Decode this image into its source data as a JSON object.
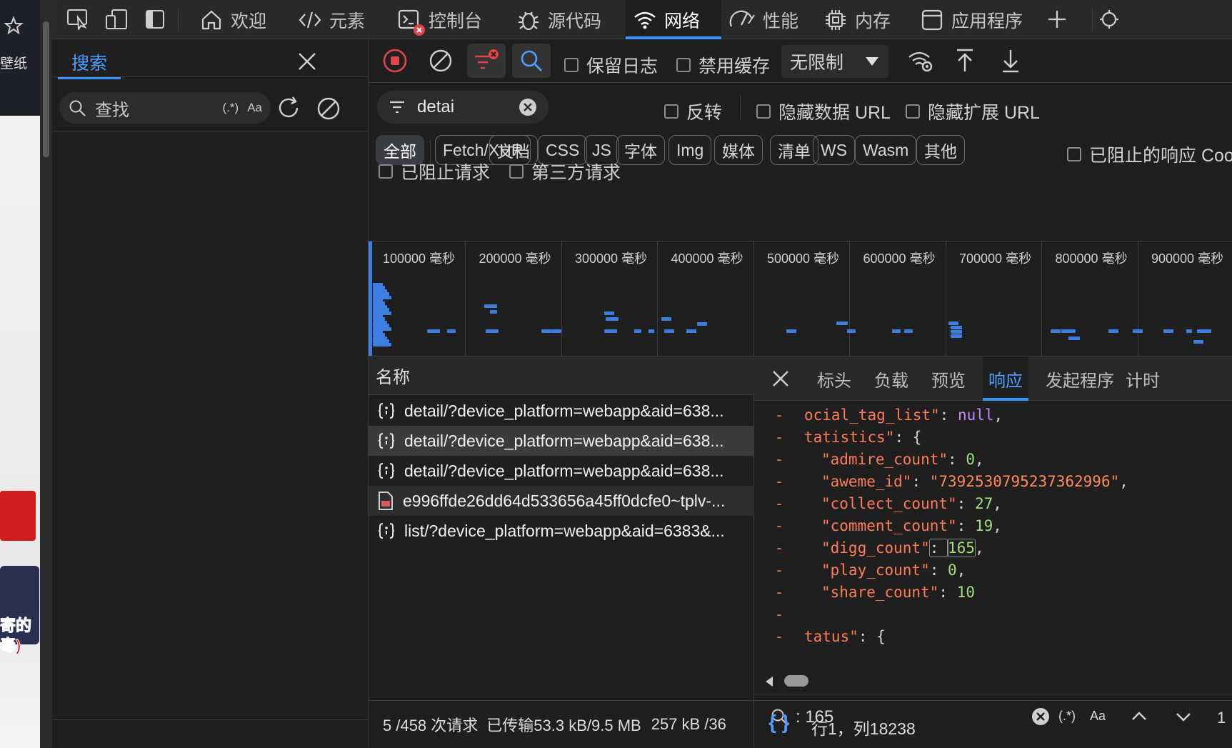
{
  "page_behind": {
    "wallpaper_label": "壁纸",
    "caption_line1": "寄的",
    "caption_line2": "毒)"
  },
  "toolbar": {
    "tabs": [
      {
        "label": "欢迎",
        "icon": "home-icon"
      },
      {
        "label": "元素",
        "icon": "code-icon"
      },
      {
        "label": "控制台",
        "icon": "console-icon"
      },
      {
        "label": "源代码",
        "icon": "bug-icon"
      },
      {
        "label": "网络",
        "icon": "wifi-icon"
      },
      {
        "label": "性能",
        "icon": "performance-icon"
      },
      {
        "label": "内存",
        "icon": "memory-chip-icon"
      },
      {
        "label": "应用程序",
        "icon": "application-icon"
      }
    ],
    "active_tab": "网络",
    "add_tab": "+"
  },
  "search_pane": {
    "tab_label": "搜索",
    "search_placeholder": "查找",
    "regex_label": "(.*)",
    "case_label": "Aa"
  },
  "network": {
    "preserve_log_label": "保留日志",
    "disable_cache_label": "禁用缓存",
    "throttling_value": "无限制",
    "filter_value": "detai",
    "invert_label": "反转",
    "hide_data_urls_label": "隐藏数据 URL",
    "hide_ext_urls_label": "隐藏扩展 URL",
    "type_filters": [
      "全部",
      "Fetch/XHR",
      "文档",
      "CSS",
      "JS",
      "字体",
      "Img",
      "媒体",
      "清单",
      "WS",
      "Wasm",
      "其他"
    ],
    "active_type_filter": "全部",
    "blocked_response_cookies_label": "已阻止的响应 Coo",
    "blocked_requests_label": "已阻止请求",
    "third_party_label": "第三方请求",
    "timeline_ticks": [
      "100000 毫秒",
      "200000 毫秒",
      "300000 毫秒",
      "400000 毫秒",
      "500000 毫秒",
      "600000 毫秒",
      "700000 毫秒",
      "800000 毫秒",
      "900000 毫秒"
    ],
    "name_column": "名称",
    "requests": [
      {
        "name": "detail/?device_platform=webapp&aid=638...",
        "icon": "fetch-icon"
      },
      {
        "name": "detail/?device_platform=webapp&aid=638...",
        "icon": "fetch-icon"
      },
      {
        "name": "detail/?device_platform=webapp&aid=638...",
        "icon": "fetch-icon"
      },
      {
        "name": "e996ffde26dd64d533656a45ff0dcfe0~tplv-...",
        "icon": "image-file-icon"
      },
      {
        "name": "list/?device_platform=webapp&aid=6383&...",
        "icon": "fetch-icon"
      }
    ],
    "status": {
      "requests": "5 /458 次请求",
      "transferred": "已传输53.3 kB/9.5 MB",
      "resources": "257 kB /36"
    }
  },
  "detail": {
    "tabs": [
      "标头",
      "负载",
      "预览",
      "响应",
      "发起程序",
      "计时"
    ],
    "active_tab": "响应",
    "code_lines": [
      {
        "gutter": "-",
        "indent": "",
        "key": "ocial_tag_list\"",
        "value": "null",
        "vtype": "nl",
        "tail": ","
      },
      {
        "gutter": "-",
        "indent": "",
        "key": "tatistics\"",
        "value": "{",
        "vtype": "p",
        "tail": ""
      },
      {
        "gutter": "-",
        "indent": "  ",
        "key": "\"admire_count\"",
        "value": "0",
        "vtype": "n",
        "tail": ","
      },
      {
        "gutter": "-",
        "indent": "  ",
        "key": "\"aweme_id\"",
        "value": "\"7392530795237362996\"",
        "vtype": "s",
        "tail": ","
      },
      {
        "gutter": "-",
        "indent": "  ",
        "key": "\"collect_count\"",
        "value": "27",
        "vtype": "n",
        "tail": ","
      },
      {
        "gutter": "-",
        "indent": "  ",
        "key": "\"comment_count\"",
        "value": "19",
        "vtype": "n",
        "tail": ","
      },
      {
        "gutter": "-",
        "indent": "  ",
        "key": "\"digg_count\"",
        "value": "165",
        "vtype": "n",
        "tail": ","
      },
      {
        "gutter": "-",
        "indent": "  ",
        "key": "\"play_count\"",
        "value": "0",
        "vtype": "n",
        "tail": ","
      },
      {
        "gutter": "-",
        "indent": "  ",
        "key": "\"share_count\"",
        "value": "10",
        "vtype": "n",
        "tail": ""
      },
      {
        "gutter": "-",
        "indent": "",
        "key": "",
        "value": "",
        "vtype": "p",
        "tail": ""
      },
      {
        "gutter": "-",
        "indent": "",
        "key": "tatus\"",
        "value": "{",
        "vtype": "p",
        "tail": ""
      }
    ],
    "find_query": ": 165",
    "find_regex": "(.*)",
    "find_case": "Aa",
    "find_count": "1",
    "format_label": "{ }",
    "cursor_position": "行1，列18238"
  },
  "colors": {
    "accent": "#3794ff",
    "record": "#e0454b",
    "timeline_bar": "#3d7fe0",
    "json_key": "#ff7c58",
    "json_number": "#9fe07a",
    "json_null": "#c586ff"
  }
}
